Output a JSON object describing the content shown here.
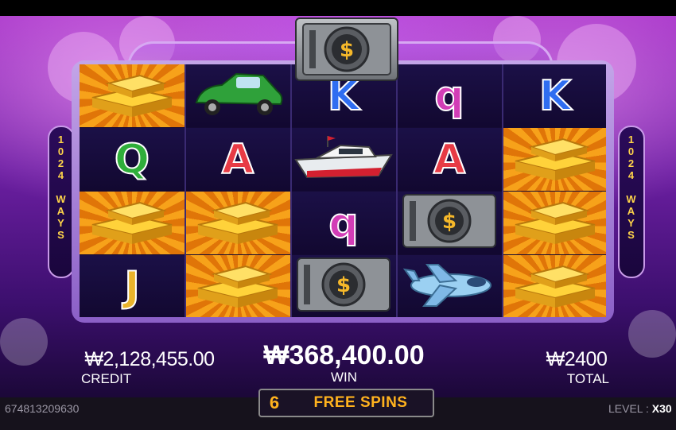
{
  "reels": {
    "side_label_left": "1\n0\n2\n4\n \nW\nA\nY\nS",
    "side_label_right": "1\n0\n2\n4\n \nW\nA\nY\nS",
    "columns": [
      [
        {
          "symbol": "gold-bars",
          "text": ""
        },
        {
          "symbol": "letter",
          "text": "Q",
          "color": "#2fae3a"
        },
        {
          "symbol": "gold-bars",
          "text": ""
        },
        {
          "symbol": "letter",
          "text": "J",
          "color": "#e9b42b"
        }
      ],
      [
        {
          "symbol": "green-car",
          "text": ""
        },
        {
          "symbol": "letter",
          "text": "A",
          "color": "#e73b45"
        },
        {
          "symbol": "gold-bars",
          "text": ""
        },
        {
          "symbol": "gold-bars",
          "text": ""
        }
      ],
      [
        {
          "symbol": "letter",
          "text": "K",
          "color": "#2f6df1"
        },
        {
          "symbol": "yacht",
          "text": ""
        },
        {
          "symbol": "letter",
          "text": "q",
          "color": "#d23db6"
        },
        {
          "symbol": "vault",
          "text": ""
        }
      ],
      [
        {
          "symbol": "letter",
          "text": "q",
          "color": "#d23db6"
        },
        {
          "symbol": "letter",
          "text": "A",
          "color": "#e73b45"
        },
        {
          "symbol": "vault",
          "text": ""
        },
        {
          "symbol": "airplane",
          "text": ""
        }
      ],
      [
        {
          "symbol": "letter",
          "text": "K",
          "color": "#2f6df1"
        },
        {
          "symbol": "gold-bars",
          "text": ""
        },
        {
          "symbol": "gold-bars",
          "text": ""
        },
        {
          "symbol": "gold-bars",
          "text": ""
        }
      ]
    ]
  },
  "hud": {
    "credit_amount": "₩2,128,455.00",
    "credit_label": "CREDIT",
    "win_amount": "₩368,400.00",
    "win_label": "WIN",
    "total_amount": "₩2400",
    "total_label": "TOTAL",
    "free_spins_count": "6",
    "free_spins_label": "FREE SPINS"
  },
  "footer": {
    "session_id": "674813209630",
    "level_label": "LEVEL : ",
    "level_value": "X30"
  },
  "colors": {
    "accent_gold": "#ffb21e",
    "background_purple": "#6d1fa3"
  }
}
